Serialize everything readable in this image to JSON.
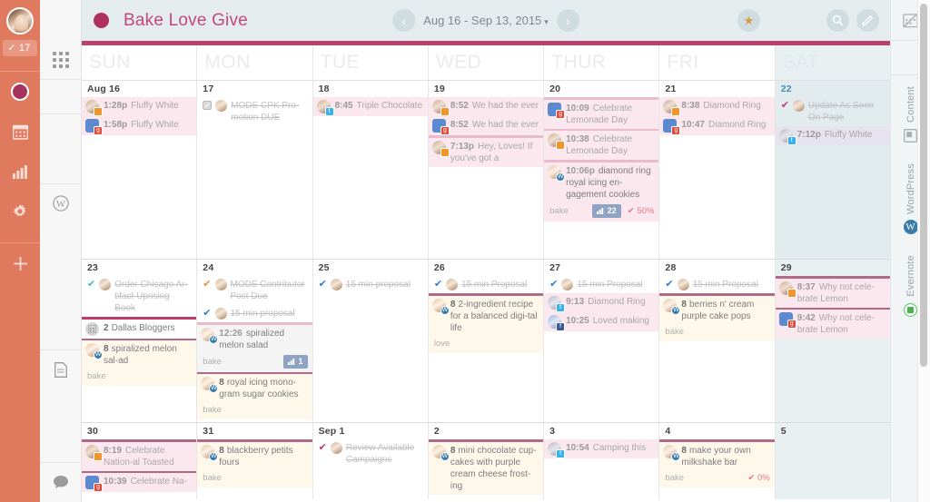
{
  "left_rail": {
    "avatar_name": "user-avatar",
    "task_badge": "17",
    "task_badge_icon": "check-icon",
    "items": [
      {
        "name": "calendar-project-active",
        "icon": "filled-circle-icon"
      },
      {
        "name": "calendar-nav",
        "icon": "calendar-icon"
      },
      {
        "name": "analytics-nav",
        "icon": "bar-chart-icon"
      },
      {
        "name": "settings-nav",
        "icon": "gear-icon"
      },
      {
        "name": "add-nav",
        "icon": "plus-icon"
      }
    ]
  },
  "filter_rail": {
    "items": [
      {
        "name": "all-filter",
        "icon": "grid-dots-icon"
      },
      {
        "name": "wordpress-filter",
        "icon": "wordpress-icon"
      },
      {
        "name": "content-filter",
        "icon": "document-icon"
      },
      {
        "name": "comments-filter",
        "icon": "comment-bubble-icon"
      }
    ]
  },
  "topbar": {
    "calendar_title": "Bake Love Give",
    "calendar_dot_color": "#b03060",
    "date_range": "Aug 16 - Sep 13, 2015",
    "date_caret": "▾",
    "prev_label": "‹",
    "next_label": "›",
    "star_label": "★",
    "search_label": "search-icon",
    "compose_label": "edit-icon"
  },
  "right_rail": {
    "top_icon": "calendar-hidden-icon",
    "groups": [
      {
        "label": "Content",
        "icon": "content-icon"
      },
      {
        "label": "WordPress",
        "icon": "wordpress-icon"
      },
      {
        "label": "Evernote",
        "icon": "evernote-icon"
      }
    ]
  },
  "calendar": {
    "day_headers": [
      "SUN",
      "MON",
      "TUE",
      "WED",
      "THUR",
      "FRI",
      "SAT"
    ],
    "weeks": [
      {
        "days": [
          {
            "num": "Aug 16",
            "items": [
              {
                "kind": "social",
                "bg": "bg-pink",
                "time": "1:28p",
                "text": "Fluffy White",
                "avatar": "a1",
                "net": "ig"
              },
              {
                "kind": "social",
                "bg": "bg-pink",
                "time": "1:58p",
                "text": "Fluffy White",
                "avatar": "blue-sq",
                "net": "gplus"
              }
            ]
          },
          {
            "num": "17",
            "items": [
              {
                "kind": "task",
                "check": "box",
                "text": "MODE CPK Pro-motion DUE",
                "strike": true,
                "avatar": "a3"
              }
            ]
          },
          {
            "num": "18",
            "items": [
              {
                "kind": "social",
                "bg": "bg-pink",
                "time": "8:45",
                "text": "Triple Chocolate",
                "avatar": "a1",
                "net": "tw"
              }
            ]
          },
          {
            "num": "19",
            "items": [
              {
                "kind": "social",
                "bg": "bg-pink",
                "time": "8:52",
                "text": "We had the ever",
                "avatar": "a1",
                "net": "ig"
              },
              {
                "kind": "social",
                "bg": "bg-pink",
                "time": "8:52",
                "text": "We had the ever",
                "avatar": "blue-sq",
                "net": "gplus"
              },
              {
                "kind": "social",
                "bg": "bg-pink",
                "bar": "bar-lpink",
                "time": "7:13p",
                "text": "Hey, Loves! If you've got a",
                "avatar": "a1",
                "net": "ig"
              }
            ]
          },
          {
            "num": "20",
            "items": [
              {
                "kind": "social",
                "bg": "bg-pink",
                "bar": "bar-lpink",
                "time": "10:09",
                "text": "Celebrate Lemonade Day",
                "avatar": "blue-sq",
                "net": "gplus"
              },
              {
                "kind": "social",
                "bg": "bg-pink",
                "bar": "bar-lpink",
                "time": "10:38",
                "text": "Celebrate Lemonade Day",
                "avatar": "a1",
                "net": "ig"
              },
              {
                "kind": "post",
                "bg": "bg-pink",
                "bar": "bar-lpink",
                "time": "10:06p",
                "text": "diamond ring royal icing en-gagement cookies",
                "avatar": "a3",
                "net": "wp",
                "footer_label": "bake",
                "pill": "22",
                "pill_icon": "bar-chart-icon",
                "pct": "50%"
              }
            ]
          },
          {
            "num": "21",
            "items": [
              {
                "kind": "social",
                "bg": "bg-pink",
                "time": "8:38",
                "text": "Diamond Ring",
                "avatar": "a1",
                "net": "ig"
              },
              {
                "kind": "social",
                "bg": "bg-pink",
                "time": "10:47",
                "text": "Diamond Ring",
                "avatar": "blue-sq",
                "net": "gplus"
              }
            ]
          },
          {
            "num": "22",
            "today": true,
            "items": [
              {
                "kind": "task",
                "check": "pink",
                "text": "Update As Seen On Page",
                "strike": true,
                "avatar": "a3"
              },
              {
                "kind": "social",
                "bg": "bg-lilac",
                "time": "7:12p",
                "text": "Fluffy White",
                "avatar": "a2",
                "net": "tw"
              }
            ]
          }
        ]
      },
      {
        "days": [
          {
            "num": "23",
            "items": [
              {
                "kind": "task",
                "check": "teal",
                "text": "Order Chicago Ar-tifact Uprising Book",
                "strike": true,
                "avatar": "a3"
              },
              {
                "kind": "group",
                "bg": "bg-white",
                "bar": "bar-pink",
                "count": "2",
                "text": "Dallas Bloggers",
                "icon": "group-icon"
              },
              {
                "kind": "post",
                "bg": "bg-cream",
                "bar": "bar-mauve",
                "count": "8",
                "text": "spiralized melon sal-ad",
                "avatar": "a3",
                "net": "wp",
                "footer_label": "bake"
              }
            ]
          },
          {
            "num": "24",
            "items": [
              {
                "kind": "task",
                "check": "orange",
                "text": "MODE Contributor Post Due",
                "strike": true,
                "avatar": "a3"
              },
              {
                "kind": "task",
                "check": "blue",
                "text": "15 min proposal",
                "strike": true,
                "avatar": "a3"
              },
              {
                "kind": "post",
                "bg": "bg-grey",
                "bar": "bar-lpink",
                "time": "12:26",
                "text": "spiralized melon salad",
                "avatar": "a3",
                "net": "wp",
                "footer_label": "bake",
                "pill": "1",
                "pill_icon": "bar-chart-icon"
              },
              {
                "kind": "post",
                "bg": "bg-cream",
                "bar": "bar-mauve",
                "count": "8",
                "text": "royal icing mono-gram sugar cookies",
                "avatar": "a3",
                "net": "wp",
                "footer_label": "bake"
              }
            ]
          },
          {
            "num": "25",
            "items": [
              {
                "kind": "task",
                "check": "blue",
                "text": "15 min proposal",
                "strike": true,
                "avatar": "a3"
              }
            ]
          },
          {
            "num": "26",
            "items": [
              {
                "kind": "task",
                "check": "blue",
                "text": "15 min Proposal",
                "strike": true,
                "avatar": "a3"
              },
              {
                "kind": "post",
                "bg": "bg-cream",
                "bar": "bar-mauve",
                "count": "8",
                "text": "2-ingredient recipe for a balanced digi-tal life",
                "avatar": "a3",
                "net": "wp",
                "footer_label": "love"
              }
            ]
          },
          {
            "num": "27",
            "items": [
              {
                "kind": "task",
                "check": "blue",
                "text": "15 min Proposal",
                "strike": true,
                "avatar": "a3"
              },
              {
                "kind": "social",
                "bg": "bg-pink",
                "time": "9:13",
                "text": "Diamond Ring",
                "avatar": "a2",
                "net": "tw"
              },
              {
                "kind": "social",
                "bg": "bg-pink",
                "time": "10:25",
                "text": "Loved making",
                "avatar": "a4",
                "net": "fb"
              }
            ]
          },
          {
            "num": "28",
            "items": [
              {
                "kind": "task",
                "check": "blue",
                "text": "15 min Proposal",
                "strike": true,
                "avatar": "a3"
              },
              {
                "kind": "post",
                "bg": "bg-cream",
                "bar": "bar-mauve",
                "count": "8",
                "text": "berries n' cream purple cake pops",
                "avatar": "a3",
                "net": "wp",
                "footer_label": "bake"
              }
            ]
          },
          {
            "num": "29",
            "items": [
              {
                "kind": "social",
                "bg": "bg-pink",
                "bar": "bar-mauve",
                "time": "8:37",
                "text": "Why not cele-brate Lemon",
                "avatar": "a1",
                "net": "ig"
              },
              {
                "kind": "social",
                "bg": "bg-pink",
                "bar": "bar-mauve",
                "time": "9:42",
                "text": "Why not cele-brate Lemon",
                "avatar": "blue-sq",
                "net": "gplus"
              }
            ]
          }
        ]
      },
      {
        "days": [
          {
            "num": "30",
            "items": [
              {
                "kind": "social",
                "bg": "bg-pink",
                "bar": "bar-mauve",
                "time": "8:19",
                "text": "Celebrate Nation-al Toasted",
                "avatar": "a1",
                "net": "ig"
              },
              {
                "kind": "social",
                "bg": "bg-pink",
                "bar": "bar-mauve",
                "time": "10:39",
                "text": "Celebrate Na-",
                "avatar": "blue-sq",
                "net": "gplus"
              }
            ]
          },
          {
            "num": "31",
            "items": [
              {
                "kind": "post",
                "bg": "bg-cream",
                "bar": "bar-mauve",
                "count": "8",
                "text": "blackberry petits fours",
                "avatar": "a3",
                "net": "wp",
                "footer_label": "bake"
              }
            ]
          },
          {
            "num": "Sep 1",
            "items": [
              {
                "kind": "task",
                "check": "pink",
                "text": "Review Available Campaigns",
                "strike": true,
                "avatar": "a3"
              }
            ]
          },
          {
            "num": "2",
            "items": [
              {
                "kind": "post",
                "bg": "bg-cream",
                "bar": "bar-mauve",
                "count": "8",
                "text": "mini chocolate cup-cakes with purple cream cheese frost-ing",
                "avatar": "a3",
                "net": "wp"
              }
            ]
          },
          {
            "num": "3",
            "items": [
              {
                "kind": "social",
                "bg": "bg-pink",
                "time": "10:54",
                "text": "Camping this",
                "avatar": "a2",
                "net": "tw"
              }
            ]
          },
          {
            "num": "4",
            "items": [
              {
                "kind": "post",
                "bg": "bg-cream",
                "bar": "bar-mauve",
                "count": "8",
                "text": "make your own milkshake bar",
                "avatar": "a3",
                "net": "wp",
                "footer_label": "bake",
                "pct": "0%"
              }
            ]
          },
          {
            "num": "5",
            "items": []
          }
        ]
      }
    ]
  }
}
